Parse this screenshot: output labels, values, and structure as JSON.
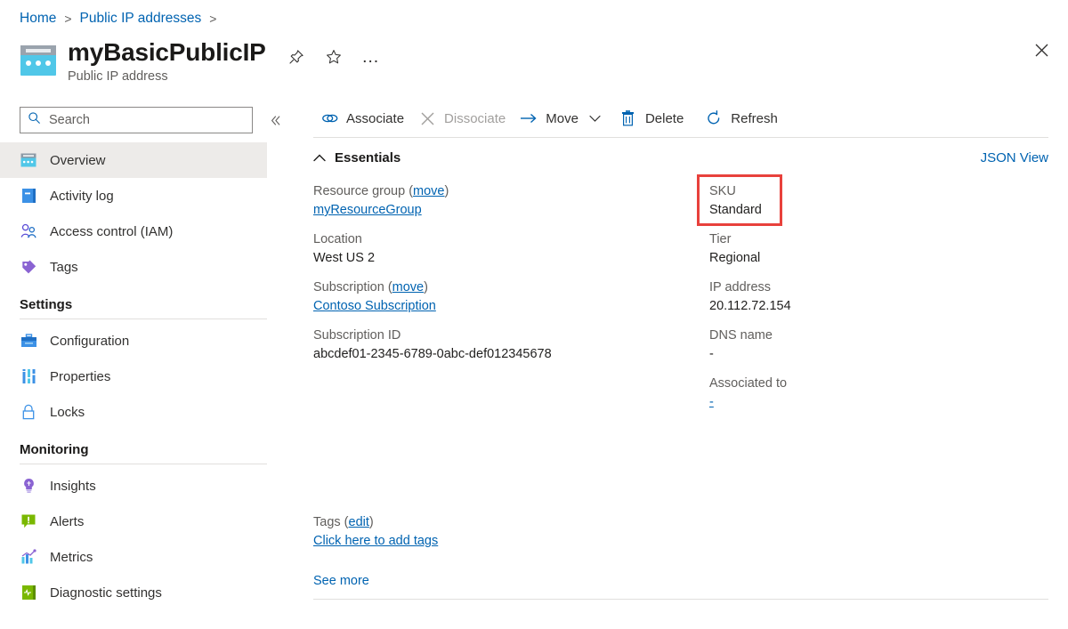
{
  "breadcrumb": {
    "items": [
      "Home",
      "Public IP addresses"
    ],
    "separator": ">"
  },
  "header": {
    "title": "myBasicPublicIP",
    "subtitle": "Public IP address",
    "resource_icon": "public-ip-address-icon",
    "actions": [
      {
        "name": "pin-icon",
        "label": "Pin"
      },
      {
        "name": "favorite-star-icon",
        "label": "Favorite"
      },
      {
        "name": "more-ellipsis-icon",
        "label": "…"
      }
    ],
    "close_label": "Close"
  },
  "sidebar": {
    "search": {
      "placeholder": "Search",
      "value": "",
      "icon": "search-icon"
    },
    "collapse_icon": "chevron-double-left-icon",
    "items": [
      {
        "label": "Overview",
        "icon": "overview-icon",
        "selected": true
      },
      {
        "label": "Activity log",
        "icon": "activity-log-icon",
        "selected": false
      },
      {
        "label": "Access control (IAM)",
        "icon": "access-control-icon",
        "selected": false
      },
      {
        "label": "Tags",
        "icon": "tags-icon",
        "selected": false
      }
    ],
    "groups": [
      {
        "title": "Settings",
        "items": [
          {
            "label": "Configuration",
            "icon": "configuration-icon"
          },
          {
            "label": "Properties",
            "icon": "properties-icon"
          },
          {
            "label": "Locks",
            "icon": "lock-icon"
          }
        ]
      },
      {
        "title": "Monitoring",
        "items": [
          {
            "label": "Insights",
            "icon": "insights-lightbulb-icon"
          },
          {
            "label": "Alerts",
            "icon": "alerts-icon"
          },
          {
            "label": "Metrics",
            "icon": "metrics-chart-icon"
          },
          {
            "label": "Diagnostic settings",
            "icon": "diagnostic-settings-icon"
          }
        ]
      }
    ]
  },
  "toolbar": {
    "associate": {
      "label": "Associate",
      "icon": "link-icon",
      "disabled": false
    },
    "dissociate": {
      "label": "Dissociate",
      "icon": "x-icon",
      "disabled": true
    },
    "move": {
      "label": "Move",
      "icon": "arrow-right-icon",
      "disabled": false,
      "caret": "chevron-down-icon"
    },
    "delete": {
      "label": "Delete",
      "icon": "trash-icon",
      "disabled": false
    },
    "refresh": {
      "label": "Refresh",
      "icon": "refresh-icon",
      "disabled": false
    }
  },
  "essentials": {
    "header_label": "Essentials",
    "collapse_icon": "chevron-up-icon",
    "json_view_label": "JSON View",
    "left_fields": [
      {
        "label": "Resource group",
        "link_suffix": "move",
        "value": "myResourceGroup",
        "value_is_link": true
      },
      {
        "label": "Location",
        "link_suffix": null,
        "value": "West US 2",
        "value_is_link": false
      },
      {
        "label": "Subscription",
        "link_suffix": "move",
        "value": "Contoso Subscription",
        "value_is_link": true
      },
      {
        "label": "Subscription ID",
        "link_suffix": null,
        "value": "abcdef01-2345-6789-0abc-def012345678",
        "value_is_link": false
      }
    ],
    "right_fields": [
      {
        "label": "SKU",
        "value": "Standard",
        "value_is_link": false,
        "highlighted": true
      },
      {
        "label": "Tier",
        "value": "Regional",
        "value_is_link": false,
        "highlighted": false
      },
      {
        "label": "IP address",
        "value": "20.112.72.154",
        "value_is_link": false,
        "highlighted": false
      },
      {
        "label": "DNS name",
        "value": "-",
        "value_is_link": false,
        "highlighted": false
      },
      {
        "label": "Associated to",
        "value": "-",
        "value_is_link": true,
        "highlighted": false
      }
    ],
    "tags": {
      "label": "Tags",
      "edit_label": "edit",
      "value": "Click here to add tags"
    },
    "see_more_label": "See more"
  },
  "colors": {
    "link": "#0063b1",
    "highlight_border": "#e8413c",
    "selected_nav_bg": "#edebe9",
    "muted_text": "#605e5c"
  }
}
